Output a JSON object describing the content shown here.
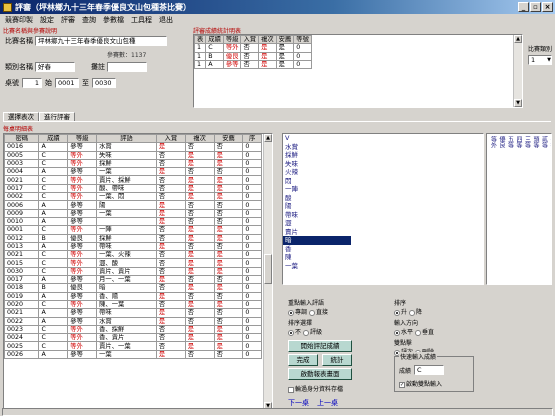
{
  "window": {
    "title": "評審（坪林鄉九十三年春季優良文山包種茶比賽）",
    "buttons": [
      "_",
      "▫",
      "×"
    ]
  },
  "menu": [
    "競賽印製",
    "設定",
    "評審",
    "查詢",
    "參數檔",
    "工具程",
    "退出"
  ],
  "contest": {
    "group_title": "比賽名稱與參賽說明",
    "name_label": "比賽名稱",
    "name_value": "坪林鄉九十三年春季優良文山包種",
    "entries_label": "參賽數：1137",
    "category_label": "類別名稱",
    "category_value": "好春",
    "rank_label": "攤註",
    "rank_value": "",
    "table_label": "桌號",
    "table_value": "1",
    "from_label": "始",
    "from_value": "0001",
    "to_label": "至",
    "to_value": "0030"
  },
  "stats": {
    "group_title": "評審成績統計明表",
    "headers": [
      "表",
      "成績",
      "等級",
      "入賞",
      "複次",
      "安薦",
      "等號"
    ],
    "rows": [
      [
        "1",
        "C",
        "等外",
        "否",
        "是",
        "是",
        "0"
      ],
      [
        "1",
        "B",
        "優良",
        "否",
        "是",
        "是",
        "0"
      ],
      [
        "1",
        "A",
        "參等",
        "否",
        "是",
        "是",
        "0"
      ]
    ]
  },
  "stats_side": {
    "label": "比賽類別",
    "value": "1"
  },
  "tabs": [
    "選擇表次",
    "進行評審"
  ],
  "detail": {
    "group_title": "每桌明細表",
    "headers": [
      "密碼",
      "成績",
      "等級",
      "評語",
      "入賞",
      "複次",
      "安薦",
      "序"
    ],
    "rows": [
      [
        "0016",
        "A",
        "參等",
        "水賞",
        "是",
        "否",
        "否",
        "0"
      ],
      [
        "0005",
        "C",
        "等外",
        "失味",
        "否",
        "是",
        "是",
        "0"
      ],
      [
        "0003",
        "C",
        "等外",
        "採鮮",
        "否",
        "是",
        "是",
        "0"
      ],
      [
        "0004",
        "A",
        "參等",
        "一葉",
        "是",
        "否",
        "否",
        "0"
      ],
      [
        "0021",
        "C",
        "等外",
        "賣片、採鮮",
        "否",
        "是",
        "是",
        "0"
      ],
      [
        "0017",
        "C",
        "等外",
        "酸、帶味",
        "否",
        "是",
        "是",
        "0"
      ],
      [
        "0002",
        "C",
        "等外",
        "一葉、悶",
        "否",
        "是",
        "是",
        "0"
      ],
      [
        "0006",
        "A",
        "參等",
        "陽",
        "是",
        "否",
        "否",
        "0"
      ],
      [
        "0009",
        "A",
        "參等",
        "一葉",
        "是",
        "否",
        "否",
        "0"
      ],
      [
        "0010",
        "A",
        "參等",
        "",
        "是",
        "否",
        "否",
        "0"
      ],
      [
        "0001",
        "C",
        "等外",
        "一陣",
        "否",
        "是",
        "是",
        "0"
      ],
      [
        "0012",
        "B",
        "優良",
        "採鮮",
        "否",
        "是",
        "是",
        "0"
      ],
      [
        "0013",
        "A",
        "參等",
        "帶味",
        "是",
        "否",
        "否",
        "0"
      ],
      [
        "0021",
        "C",
        "等外",
        "一葉、火辣",
        "否",
        "是",
        "是",
        "0"
      ],
      [
        "0015",
        "C",
        "等外",
        "澀、酸",
        "否",
        "是",
        "是",
        "0"
      ],
      [
        "0030",
        "C",
        "等外",
        "賣片、賣片",
        "否",
        "是",
        "是",
        "0"
      ],
      [
        "0017",
        "A",
        "參等",
        "月一、一葉",
        "是",
        "否",
        "否",
        "0"
      ],
      [
        "0018",
        "B",
        "優良",
        "暗",
        "否",
        "是",
        "是",
        "0"
      ],
      [
        "0019",
        "A",
        "參等",
        "香、陽",
        "是",
        "否",
        "否",
        "0"
      ],
      [
        "0020",
        "C",
        "等外",
        "陳、一葉",
        "否",
        "是",
        "是",
        "0"
      ],
      [
        "0021",
        "A",
        "參等",
        "帶味",
        "是",
        "否",
        "否",
        "0"
      ],
      [
        "0022",
        "A",
        "參等",
        "水賞",
        "是",
        "否",
        "否",
        "0"
      ],
      [
        "0023",
        "C",
        "等外",
        "香、採鮮",
        "否",
        "是",
        "是",
        "0"
      ],
      [
        "0024",
        "C",
        "等外",
        "香、賣片",
        "否",
        "是",
        "是",
        "0"
      ],
      [
        "0025",
        "C",
        "等外",
        "賣片、一葉",
        "否",
        "是",
        "是",
        "0"
      ],
      [
        "0026",
        "A",
        "參等",
        "一葉",
        "是",
        "否",
        "否",
        "0"
      ]
    ]
  },
  "comment_list": {
    "items": [
      "V",
      "水賞",
      "採鮮",
      "失味",
      "火辣",
      "悶",
      "一陣",
      "酸",
      "陽",
      "帶味",
      "澀",
      "賣片",
      "暗",
      "香",
      "陳",
      "一葉"
    ],
    "selected_index": 12
  },
  "grade_list": [
    "特等",
    "參等",
    "貳等",
    "頭等",
    "三等",
    "四等",
    "五等",
    "優良",
    "等外"
  ],
  "controls": {
    "input_method_title": "重點輸入評語",
    "input_opt1": "專調",
    "input_opt2": "直接",
    "sort_title": "排序選擇",
    "sort_opt1": "不",
    "sort_opt2": "評級",
    "order_title": "排序",
    "order_opt1": "升",
    "order_opt2": "降",
    "dir_title": "輸入方向",
    "dir_opt1": "水平",
    "dir_opt2": "垂直",
    "dup_title": "雙點擊",
    "dup_opt1": "評次",
    "dup_opt2": "刪除",
    "score_group_title": "快速輸入成績",
    "score_label": "成績",
    "score_value": "C",
    "auto_label": "啟動雙點輸入",
    "btn_start": "開始評記成績",
    "btn_done": "完成",
    "btn_stats": "統計",
    "btn_print": "啟動報表畫面",
    "next_check": "輪過身分資料存檔",
    "nav_next": "下一桌",
    "nav_prev": "上一桌"
  }
}
